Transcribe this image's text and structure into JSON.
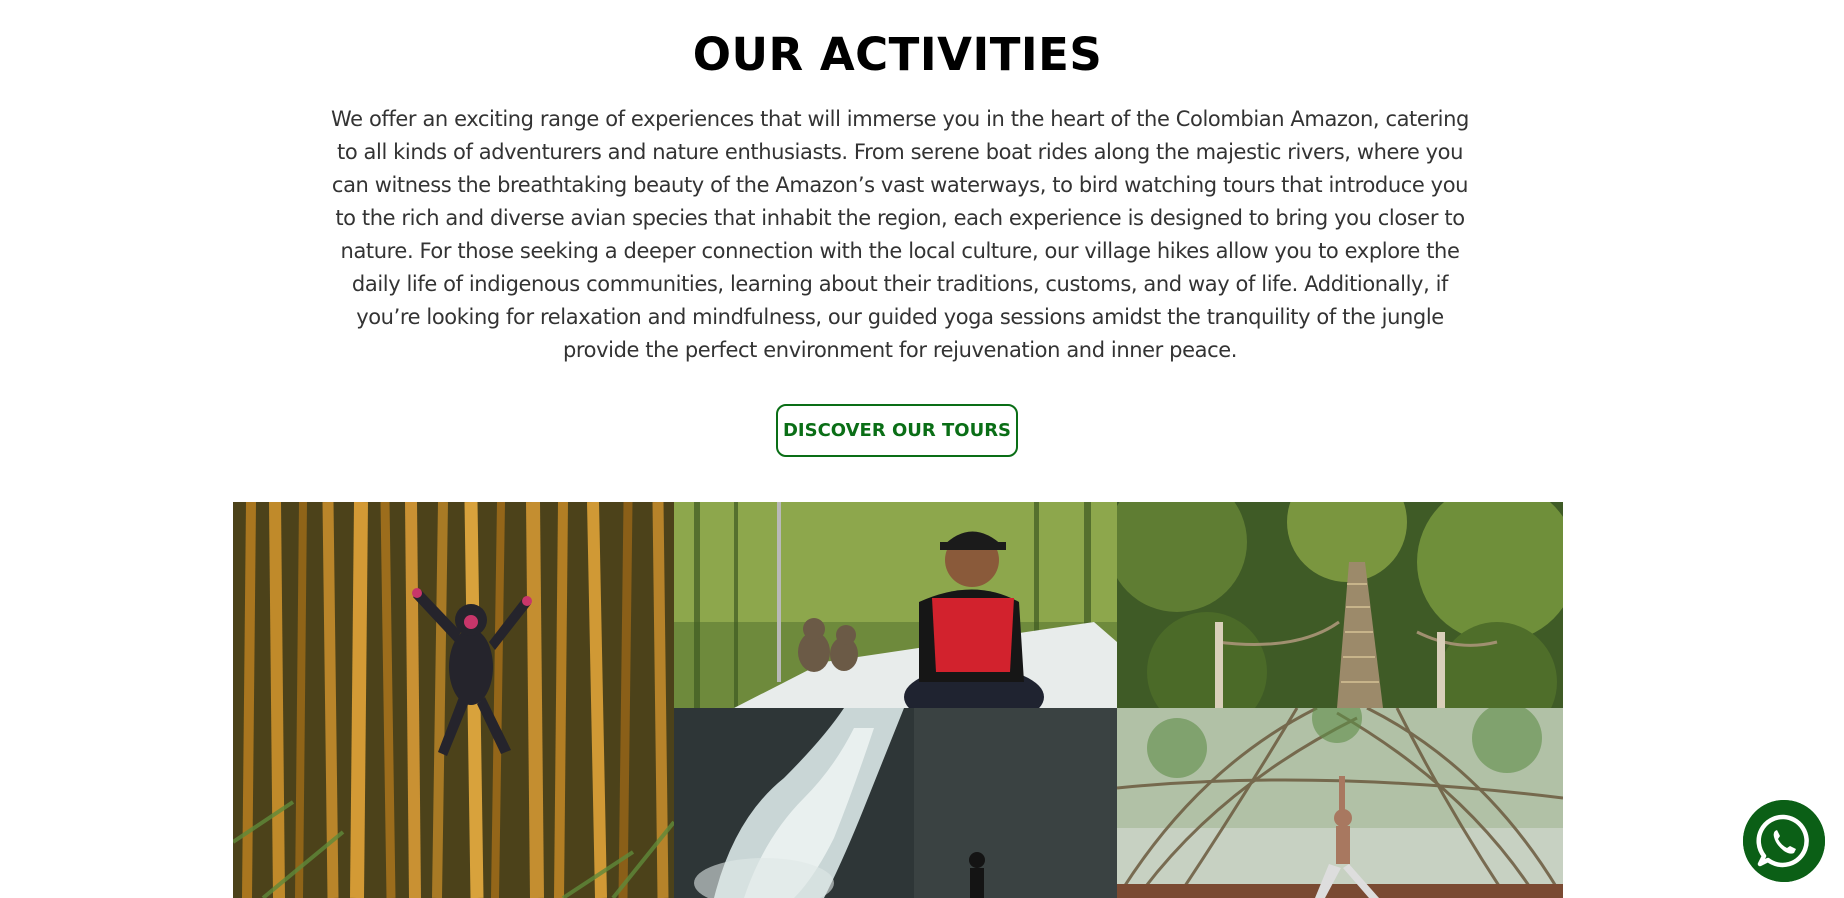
{
  "section": {
    "title": "OUR ACTIVITIES",
    "description": "We offer an exciting range of experiences that will immerse you in the heart of the Colombian Amazon, catering to all kinds of adventurers and nature enthusiasts. From serene boat rides along the majestic rivers, where you can witness the breathtaking beauty of the Amazon’s vast waterways, to bird watching tours that introduce you to the rich and diverse avian species that inhabit the region, each experience is designed to bring you closer to nature. For those seeking a deeper connection with the local culture, our village hikes allow you to explore the daily life of indigenous communities, learning about their traditions, customs, and way of life. Additionally, if you’re looking for relaxation and mindfulness, our guided yoga sessions amidst the tranquility of the jungle provide the perfect environment for rejuvenation and inner peace.",
    "cta_label": "DISCOVER OUR TOURS"
  },
  "colors": {
    "accent_green": "#0a6e16",
    "whatsapp_green": "#0b5f16"
  },
  "gallery": {
    "images": [
      {
        "subject": "bamboo-forest-with-monkey-figure"
      },
      {
        "subject": "man-in-life-vest-on-boat-with-monkeys"
      },
      {
        "subject": "jungle-canopy-rope-bridge"
      },
      {
        "subject": "waterfall-with-hiker"
      },
      {
        "subject": "yoga-pose-in-bamboo-grove"
      }
    ]
  },
  "floating": {
    "icon": "whatsapp-icon"
  }
}
